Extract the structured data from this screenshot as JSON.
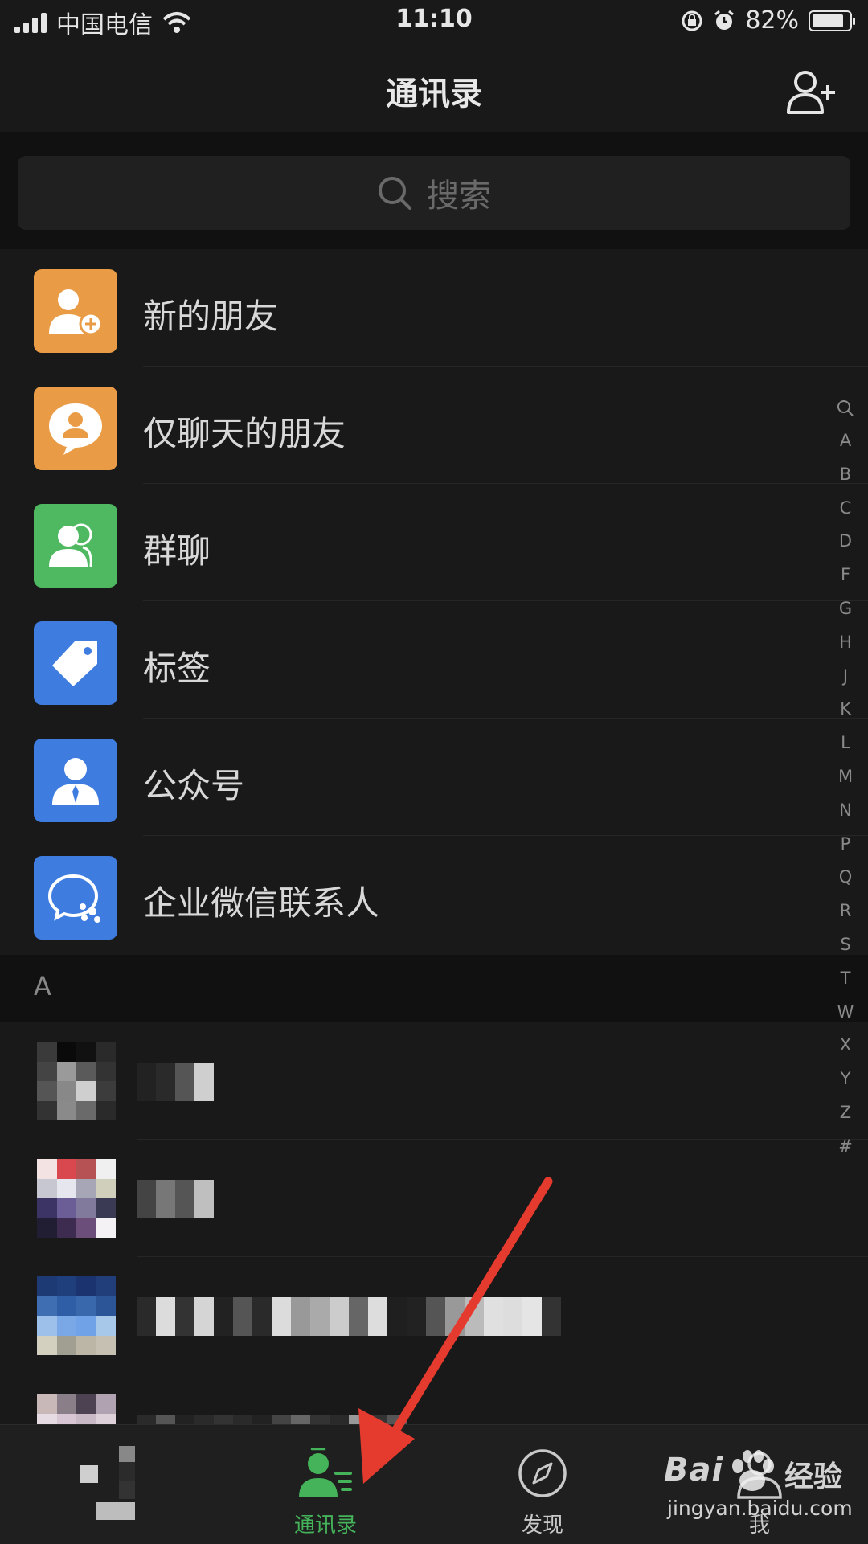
{
  "status_bar": {
    "carrier": "中国电信",
    "time": "11:10",
    "battery": "82%",
    "battery_level": 0.82
  },
  "nav": {
    "title": "通讯录"
  },
  "search": {
    "placeholder": "搜索"
  },
  "menu": [
    {
      "label": "新的朋友",
      "icon": "new-friends-icon",
      "color": "#E99C45"
    },
    {
      "label": "仅聊天的朋友",
      "icon": "chat-only-friends-icon",
      "color": "#E99C45"
    },
    {
      "label": "群聊",
      "icon": "group-chat-icon",
      "color": "#4FB961"
    },
    {
      "label": "标签",
      "icon": "tag-icon",
      "color": "#3E7CE0"
    },
    {
      "label": "公众号",
      "icon": "official-account-icon",
      "color": "#3E7CE0"
    },
    {
      "label": "企业微信联系人",
      "icon": "wecom-contacts-icon",
      "color": "#3E7CE0"
    }
  ],
  "section": {
    "letter": "A"
  },
  "index": [
    "A",
    "B",
    "C",
    "D",
    "F",
    "G",
    "H",
    "J",
    "K",
    "L",
    "M",
    "N",
    "P",
    "Q",
    "R",
    "S",
    "T",
    "W",
    "X",
    "Y",
    "Z",
    "#"
  ],
  "tabs": [
    {
      "label": "",
      "icon": "pixelated-tab-icon",
      "active": false
    },
    {
      "label": "通讯录",
      "icon": "contacts-icon",
      "active": true
    },
    {
      "label": "发现",
      "icon": "compass-icon",
      "active": false
    },
    {
      "label": "我",
      "icon": "profile-icon",
      "active": false
    }
  ],
  "watermark": {
    "brand": "Bai",
    "product": "经验",
    "url": "jingyan.baidu.com"
  },
  "colors": {
    "accent": "#44B35A",
    "annotation_arrow": "#E53A2E"
  }
}
